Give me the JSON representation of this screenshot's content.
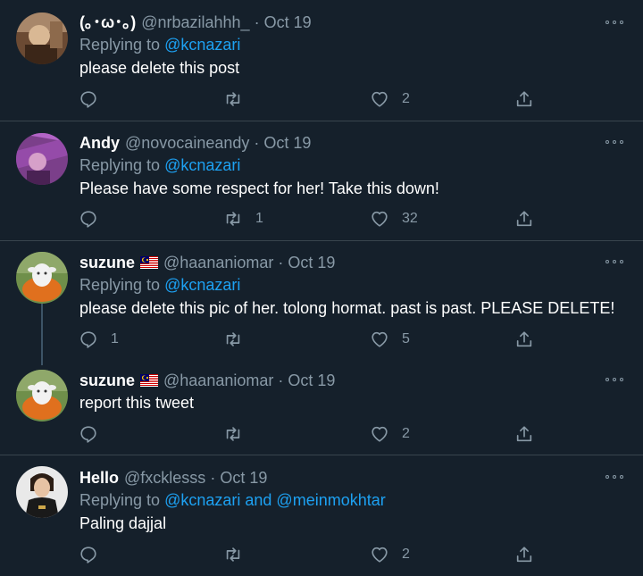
{
  "tweets": [
    {
      "name": "(｡･ω･｡)",
      "handle": "@nrbazilahhh_",
      "dot": "·",
      "date": "Oct 19",
      "replying_prefix": "Replying to ",
      "replying_to": "@kcnazari",
      "text": "please delete this post",
      "reply_count": "",
      "retweet_count": "",
      "like_count": "2"
    },
    {
      "name": "Andy",
      "handle": "@novocaineandy",
      "dot": "·",
      "date": "Oct 19",
      "replying_prefix": "Replying to ",
      "replying_to": "@kcnazari",
      "text": "Please have some respect for her! Take this down!",
      "reply_count": "",
      "retweet_count": "1",
      "like_count": "32"
    },
    {
      "name": "suzune",
      "handle": "@haananiomar",
      "dot": "·",
      "date": "Oct 19",
      "replying_prefix": "Replying to ",
      "replying_to": "@kcnazari",
      "text": "please delete this pic of her. tolong hormat. past is past. PLEASE DELETE!",
      "reply_count": "1",
      "retweet_count": "",
      "like_count": "5"
    },
    {
      "name": "suzune",
      "handle": "@haananiomar",
      "dot": "·",
      "date": "Oct 19",
      "text": "report this tweet",
      "reply_count": "",
      "retweet_count": "",
      "like_count": "2"
    },
    {
      "name": "Hello",
      "handle": "@fxcklesss",
      "dot": "·",
      "date": "Oct 19",
      "replying_prefix": "Replying to ",
      "replying_to": "@kcnazari",
      "replying_and": " and ",
      "replying_to_2": "@meinmokhtar",
      "text": "Paling dajjal",
      "reply_count": "",
      "retweet_count": "",
      "like_count": "2"
    }
  ],
  "icons": {
    "reply": "reply-icon",
    "retweet": "retweet-icon",
    "like": "heart-icon",
    "share": "share-icon",
    "more": "more-icon",
    "flag": "malaysia-flag-icon"
  },
  "colors": {
    "background": "#15202b",
    "divider": "#38444d",
    "secondary_text": "#8899a6",
    "link": "#1da1f2"
  }
}
